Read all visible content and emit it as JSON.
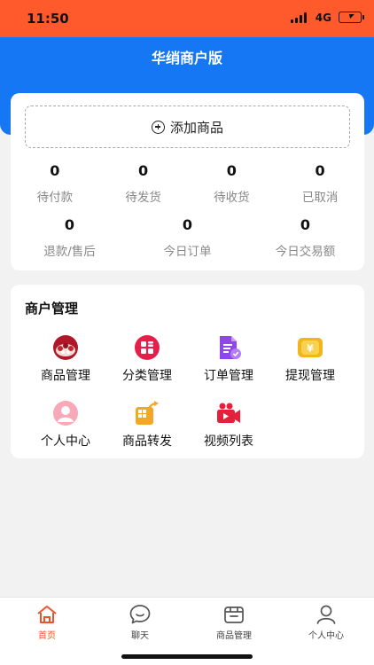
{
  "status_bar": {
    "time": "11:50",
    "network": "4G"
  },
  "header": {
    "title": "华绡商户版",
    "background": "#1577f4"
  },
  "add_product": {
    "label": "添加商品"
  },
  "order_stats": [
    {
      "value": "0",
      "label": "待付款"
    },
    {
      "value": "0",
      "label": "待发货"
    },
    {
      "value": "0",
      "label": "待收货"
    },
    {
      "value": "0",
      "label": "已取消"
    },
    {
      "value": "0",
      "label": "退款/售后"
    },
    {
      "value": "0",
      "label": "今日订单"
    },
    {
      "value": "0",
      "label": "今日交易额"
    }
  ],
  "merchant": {
    "title": "商户管理",
    "items": [
      {
        "label": "商品管理",
        "icon": "product-management-icon"
      },
      {
        "label": "分类管理",
        "icon": "category-management-icon"
      },
      {
        "label": "订单管理",
        "icon": "order-management-icon"
      },
      {
        "label": "提现管理",
        "icon": "withdraw-management-icon"
      },
      {
        "label": "个人中心",
        "icon": "personal-center-icon"
      },
      {
        "label": "商品转发",
        "icon": "product-forward-icon"
      },
      {
        "label": "视频列表",
        "icon": "video-list-icon"
      }
    ]
  },
  "tabbar": {
    "active_color": "#f2502a",
    "items": [
      {
        "label": "首页",
        "icon": "home-icon"
      },
      {
        "label": "聊天",
        "icon": "chat-icon"
      },
      {
        "label": "商品管理",
        "icon": "shop-icon"
      },
      {
        "label": "个人中心",
        "icon": "user-icon"
      }
    ]
  }
}
